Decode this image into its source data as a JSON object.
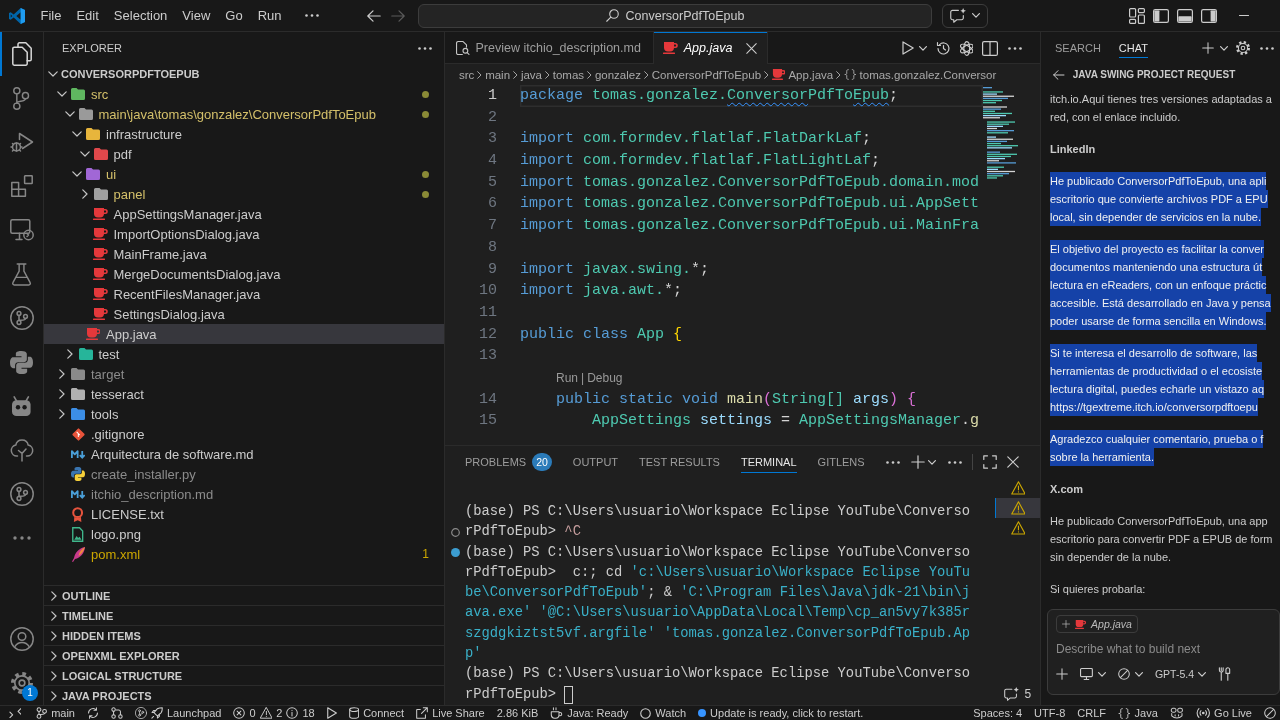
{
  "title_bar": {
    "menus": [
      "File",
      "Edit",
      "Selection",
      "View",
      "Go",
      "Run"
    ],
    "nav_buttons": [
      {
        "kind": "back",
        "disabled": false
      },
      {
        "kind": "forward",
        "disabled": true
      }
    ],
    "command_center": "ConversorPdfToEpub"
  },
  "activity_bar": {
    "items": [
      {
        "kind": "explorer",
        "selected": true
      },
      {
        "kind": "scm",
        "selected": false
      },
      {
        "kind": "debug",
        "selected": false
      },
      {
        "kind": "extensions",
        "selected": false
      },
      {
        "kind": "remote",
        "selected": false
      },
      {
        "kind": "testing",
        "selected": false
      },
      {
        "kind": "gitlens",
        "selected": false
      },
      {
        "kind": "python",
        "selected": false
      },
      {
        "kind": "robot",
        "selected": false
      },
      {
        "kind": "tree",
        "selected": false
      },
      {
        "kind": "graph",
        "selected": false
      },
      {
        "kind": "more",
        "selected": false
      }
    ],
    "bottom": [
      {
        "kind": "account"
      },
      {
        "kind": "settings",
        "badge": "1"
      }
    ]
  },
  "explorer": {
    "title": "EXPLORER",
    "tree": {
      "label": "CONVERSORPDFTOEPUB",
      "expanded": true,
      "children": [
        {
          "label": "src",
          "kind": "folder",
          "color": "#5fb760",
          "expanded": true,
          "modified": true,
          "ignored": false,
          "warning": false,
          "selected": false,
          "children": [
            {
              "label": "main\\java\\tomas\\gonzalez\\ConversorPdfToEpub",
              "kind": "folder",
              "color": "#9a9a9a",
              "expanded": true,
              "modified": true,
              "ignored": false,
              "warning": false,
              "selected": false,
              "children": [
                {
                  "label": "infrastructure",
                  "kind": "folder",
                  "color": "#e7b53c",
                  "expanded": true,
                  "modified": false,
                  "ignored": false,
                  "warning": false,
                  "selected": false,
                  "children": [
                    {
                      "label": "pdf",
                      "kind": "folder",
                      "color": "#e0484b",
                      "expanded": true,
                      "modified": false,
                      "ignored": false,
                      "warning": false,
                      "selected": false
                    }
                  ]
                },
                {
                  "label": "ui",
                  "kind": "folder",
                  "color": "#a167d6",
                  "expanded": true,
                  "modified": true,
                  "ignored": false,
                  "warning": false,
                  "selected": false,
                  "children": [
                    {
                      "label": "panel",
                      "kind": "folder",
                      "color": "#a0a0a0",
                      "expanded": false,
                      "modified": true,
                      "ignored": false,
                      "warning": false,
                      "selected": false
                    },
                    {
                      "label": "AppSettingsManager.java",
                      "kind": "java",
                      "modified": false,
                      "ignored": false,
                      "warning": false,
                      "selected": false
                    },
                    {
                      "label": "ImportOptionsDialog.java",
                      "kind": "java",
                      "modified": false,
                      "ignored": false,
                      "warning": false,
                      "selected": false
                    },
                    {
                      "label": "MainFrame.java",
                      "kind": "java",
                      "modified": false,
                      "ignored": false,
                      "warning": false,
                      "selected": false
                    },
                    {
                      "label": "MergeDocumentsDialog.java",
                      "kind": "java",
                      "modified": false,
                      "ignored": false,
                      "warning": false,
                      "selected": false
                    },
                    {
                      "label": "RecentFilesManager.java",
                      "kind": "java",
                      "modified": false,
                      "ignored": false,
                      "warning": false,
                      "selected": false
                    },
                    {
                      "label": "SettingsDialog.java",
                      "kind": "java",
                      "modified": false,
                      "ignored": false,
                      "warning": false,
                      "selected": false
                    }
                  ]
                },
                {
                  "label": "App.java",
                  "kind": "java",
                  "modified": false,
                  "ignored": false,
                  "warning": false,
                  "selected": true
                }
              ]
            },
            {
              "label": "test",
              "kind": "folder",
              "color": "#26b59a",
              "expanded": false,
              "modified": false,
              "ignored": false,
              "warning": false,
              "selected": false
            }
          ]
        },
        {
          "label": "target",
          "kind": "folder",
          "color": "#8a8a8a",
          "expanded": false,
          "modified": false,
          "ignored": true,
          "warning": false,
          "selected": false
        },
        {
          "label": "tesseract",
          "kind": "folder",
          "color": "#b0b0b0",
          "expanded": false,
          "modified": false,
          "ignored": false,
          "warning": false,
          "selected": false
        },
        {
          "label": "tools",
          "kind": "folder",
          "color": "#3c8ee6",
          "expanded": false,
          "modified": false,
          "ignored": false,
          "warning": false,
          "selected": false
        },
        {
          "label": ".gitignore",
          "kind": "git",
          "modified": false,
          "ignored": false,
          "warning": false,
          "selected": false
        },
        {
          "label": "Arquitectura de software.md",
          "kind": "markdown",
          "modified": false,
          "ignored": false,
          "warning": false,
          "selected": false
        },
        {
          "label": "create_installer.py",
          "kind": "python",
          "modified": false,
          "ignored": true,
          "warning": false,
          "selected": false
        },
        {
          "label": "itchio_description.md",
          "kind": "markdown",
          "modified": false,
          "ignored": true,
          "warning": false,
          "selected": false
        },
        {
          "label": "LICENSE.txt",
          "kind": "license",
          "modified": false,
          "ignored": false,
          "warning": false,
          "selected": false
        },
        {
          "label": "logo.png",
          "kind": "image",
          "modified": false,
          "ignored": false,
          "warning": false,
          "selected": false
        },
        {
          "label": "pom.xml",
          "kind": "xml",
          "modified": false,
          "ignored": false,
          "warning": true,
          "badge": "1",
          "selected": false
        }
      ]
    },
    "sections": [
      {
        "label": "OUTLINE",
        "expanded": false
      },
      {
        "label": "TIMELINE",
        "expanded": false
      },
      {
        "label": "HIDDEN ITEMS",
        "expanded": false
      },
      {
        "label": "OPENXML EXPLORER",
        "expanded": false
      },
      {
        "label": "LOGICAL STRUCTURE",
        "expanded": false
      },
      {
        "label": "JAVA PROJECTS",
        "expanded": false
      }
    ]
  },
  "editor": {
    "tabs": [
      {
        "label": "Preview itchio_description.md",
        "kind": "preview",
        "selected": false,
        "preview_mode": false
      },
      {
        "label": "App.java",
        "kind": "java",
        "selected": true,
        "preview_mode": true
      }
    ],
    "breadcrumbs": [
      {
        "label": "src",
        "kind": "folder"
      },
      {
        "label": "main",
        "kind": "folder"
      },
      {
        "label": "java",
        "kind": "folder"
      },
      {
        "label": "tomas",
        "kind": "folder"
      },
      {
        "label": "gonzalez",
        "kind": "folder"
      },
      {
        "label": "ConversorPdfToEpub",
        "kind": "folder"
      },
      {
        "label": "App.java",
        "kind": "java"
      },
      {
        "label": "tomas.gonzalez.Conversor",
        "kind": "namespace"
      }
    ],
    "lines": [
      {
        "kind": "code",
        "number": "1",
        "current": true,
        "tokens": [
          {
            "kind": "keyword",
            "text": "package "
          },
          {
            "kind": "type",
            "text": "tomas.gonzalez.",
            "squiggle": false
          },
          {
            "kind": "type",
            "text": "Conversor",
            "squiggle": true
          },
          {
            "kind": "type",
            "text": "PdfTo",
            "squiggle": false
          },
          {
            "kind": "type",
            "text": "Epub",
            "squiggle": true
          },
          {
            "kind": "plain",
            "text": ";"
          }
        ]
      },
      {
        "kind": "code",
        "number": "2",
        "current": false
      },
      {
        "kind": "code",
        "number": "3",
        "current": false,
        "tokens": [
          {
            "kind": "keyword",
            "text": "import "
          },
          {
            "kind": "type",
            "text": "com.formdev.flatlaf.FlatDarkLaf"
          },
          {
            "kind": "plain",
            "text": ";"
          }
        ]
      },
      {
        "kind": "code",
        "number": "4",
        "current": false,
        "tokens": [
          {
            "kind": "keyword",
            "text": "import "
          },
          {
            "kind": "type",
            "text": "com.formdev.flatlaf.FlatLightLaf"
          },
          {
            "kind": "plain",
            "text": ";"
          }
        ]
      },
      {
        "kind": "code",
        "number": "5",
        "current": false,
        "tokens": [
          {
            "kind": "keyword",
            "text": "import "
          },
          {
            "kind": "type",
            "text": "tomas.gonzalez.ConversorPdfToEpub.domain.mod"
          }
        ]
      },
      {
        "kind": "code",
        "number": "6",
        "current": false,
        "tokens": [
          {
            "kind": "keyword",
            "text": "import "
          },
          {
            "kind": "type",
            "text": "tomas.gonzalez.ConversorPdfToEpub.ui.AppSett"
          }
        ]
      },
      {
        "kind": "code",
        "number": "7",
        "current": false,
        "tokens": [
          {
            "kind": "keyword",
            "text": "import "
          },
          {
            "kind": "type",
            "text": "tomas.gonzalez.ConversorPdfToEpub.ui.MainFra"
          }
        ]
      },
      {
        "kind": "code",
        "number": "8",
        "current": false
      },
      {
        "kind": "code",
        "number": "9",
        "current": false,
        "tokens": [
          {
            "kind": "keyword",
            "text": "import "
          },
          {
            "kind": "type",
            "text": "javax.swing."
          },
          {
            "kind": "plain",
            "text": "*;"
          }
        ]
      },
      {
        "kind": "code",
        "number": "10",
        "current": false,
        "tokens": [
          {
            "kind": "keyword",
            "text": "import "
          },
          {
            "kind": "type",
            "text": "java.awt."
          },
          {
            "kind": "plain",
            "text": "*;"
          }
        ]
      },
      {
        "kind": "code",
        "number": "11",
        "current": false
      },
      {
        "kind": "code",
        "number": "12",
        "current": false,
        "tokens": [
          {
            "kind": "keyword",
            "text": "public class "
          },
          {
            "kind": "type",
            "text": "App "
          },
          {
            "kind": "bracket1",
            "text": "{"
          }
        ]
      },
      {
        "kind": "code",
        "number": "13",
        "current": false
      },
      {
        "kind": "codelens",
        "links": [
          "Run",
          "Debug"
        ],
        "separator": "|"
      },
      {
        "kind": "code",
        "number": "14",
        "current": false,
        "tokens": [
          {
            "kind": "keyword",
            "text": "    public static void "
          },
          {
            "kind": "func",
            "text": "main"
          },
          {
            "kind": "bracket2",
            "text": "("
          },
          {
            "kind": "type",
            "text": "String[] "
          },
          {
            "kind": "var",
            "text": "args"
          },
          {
            "kind": "bracket2",
            "text": ") {"
          }
        ]
      },
      {
        "kind": "code",
        "number": "15",
        "current": false,
        "tokens": [
          {
            "kind": "type",
            "text": "        AppSettings "
          },
          {
            "kind": "var",
            "text": "settings "
          },
          {
            "kind": "plain",
            "text": "= "
          },
          {
            "kind": "type",
            "text": "AppSettingsManager"
          },
          {
            "kind": "plain",
            "text": "."
          },
          {
            "kind": "func",
            "text": "g"
          }
        ]
      }
    ]
  },
  "panel": {
    "tabs": [
      {
        "label": "PROBLEMS",
        "badge": "20",
        "selected": false
      },
      {
        "label": "OUTPUT",
        "selected": false
      },
      {
        "label": "TEST RESULTS",
        "selected": false
      },
      {
        "label": "TERMINAL",
        "selected": true
      },
      {
        "label": "GITLENS",
        "selected": false
      }
    ],
    "terminal": [
      {
        "kind": "plain",
        "cursor": false,
        "tokens": [
          {
            "kind": "plain",
            "text": "(base) PS C:\\Users\\usuario\\Workspace Eclipse YouTube\\Converso"
          }
        ]
      },
      {
        "kind": "pending",
        "cursor": false,
        "tokens": [
          {
            "kind": "plain",
            "text": "rPdfToEpub> "
          },
          {
            "kind": "ctrl",
            "text": "^C"
          }
        ]
      },
      {
        "kind": "success",
        "cursor": false,
        "tokens": [
          {
            "kind": "plain",
            "text": "(base) PS C:\\Users\\usuario\\Workspace Eclipse YouTube\\Converso"
          }
        ]
      },
      {
        "kind": "plain",
        "cursor": false,
        "tokens": [
          {
            "kind": "plain",
            "text": "rPdfToEpub>  c:; cd "
          },
          {
            "kind": "string",
            "text": "'c:\\Users\\usuario\\Workspace Eclipse YouTu"
          }
        ]
      },
      {
        "kind": "plain",
        "cursor": false,
        "tokens": [
          {
            "kind": "string",
            "text": "be\\ConversorPdfToEpub'"
          },
          {
            "kind": "plain",
            "text": "; & "
          },
          {
            "kind": "string",
            "text": "'C:\\Program Files\\Java\\jdk-21\\bin\\j"
          }
        ]
      },
      {
        "kind": "plain",
        "cursor": false,
        "tokens": [
          {
            "kind": "string",
            "text": "ava.exe' '@C:\\Users\\usuario\\AppData\\Local\\Temp\\cp_an5vy7k385r"
          }
        ]
      },
      {
        "kind": "plain",
        "cursor": false,
        "tokens": [
          {
            "kind": "string",
            "text": "szgdgkiztst5vf.argfile' 'tomas.gonzalez.ConversorPdfToEpub.Ap"
          }
        ]
      },
      {
        "kind": "plain",
        "cursor": false,
        "tokens": [
          {
            "kind": "string",
            "text": "p'"
          }
        ]
      },
      {
        "kind": "plain",
        "cursor": false,
        "tokens": [
          {
            "kind": "plain",
            "text": "(base) PS C:\\Users\\usuario\\Workspace Eclipse YouTube\\Converso"
          }
        ]
      },
      {
        "kind": "plain",
        "cursor": true,
        "tokens": [
          {
            "kind": "plain",
            "text": "rPdfToEpub> "
          }
        ]
      }
    ],
    "terminal_tabs": [
      {
        "selected": false
      },
      {
        "selected": true
      },
      {
        "selected": false
      }
    ],
    "chat_count": "5"
  },
  "chat": {
    "tabs": [
      {
        "label": "SEARCH",
        "selected": false
      },
      {
        "label": "CHAT",
        "selected": true
      }
    ],
    "title": "JAVA SWING PROJECT REQUEST",
    "messages": [
      {
        "kind": "text",
        "selected": false,
        "lines": [
          "itch.io.Aquí tienes tres versiones adaptadas a",
          "red, con el enlace incluido."
        ]
      },
      {
        "kind": "heading",
        "selected": false,
        "lines": [
          "LinkedIn"
        ]
      },
      {
        "kind": "text",
        "selected": true,
        "lines": [
          "He publicado ConversorPdfToEpub, una apli",
          "escritorio que convierte archivos PDF a EPU",
          "local, sin depender de servicios en la nube."
        ]
      },
      {
        "kind": "text",
        "selected": true,
        "lines": [
          "El objetivo del proyecto es facilitar la conver",
          "documentos manteniendo una estructura út",
          "lectura en eReaders, con un enfoque práctic",
          "accesible. Está desarrollado en Java y pensa",
          "poder usarse de forma sencilla en Windows."
        ]
      },
      {
        "kind": "text",
        "selected": true,
        "lines": [
          "Si te interesa el desarrollo de software, las",
          "herramientas de productividad o el ecosiste",
          "lectura digital, puedes echarle un vistazo aq",
          "https://tgextreme.itch.io/conversorpdftoepu"
        ]
      },
      {
        "kind": "text",
        "selected": true,
        "lines": [
          "Agradezco cualquier comentario, prueba o f",
          "sobre la herramienta."
        ]
      },
      {
        "kind": "heading",
        "selected": false,
        "lines": [
          "X.com"
        ]
      },
      {
        "kind": "text",
        "selected": false,
        "lines": [
          "He publicado ConversorPdfToEpub, una app",
          "escritorio para convertir PDF a EPUB de form",
          "sin depender de la nube."
        ]
      },
      {
        "kind": "text",
        "selected": false,
        "lines": [
          "Si quieres probarla:"
        ]
      }
    ],
    "input": {
      "attachment": "App.java",
      "placeholder": "Describe what to build next",
      "model": "GPT-5.4"
    }
  },
  "status_bar": {
    "left": [
      {
        "kind": "remote"
      },
      {
        "kind": "branch",
        "text": "main"
      },
      {
        "kind": "sync"
      },
      {
        "kind": "graph"
      },
      {
        "kind": "launchpad",
        "text": "Launchpad"
      },
      {
        "kind": "problems",
        "errors": "0",
        "warnings": "2",
        "infos": "18"
      },
      {
        "kind": "run"
      },
      {
        "kind": "database",
        "text": "Connect"
      },
      {
        "kind": "liveshare",
        "text": "Live Share"
      },
      {
        "kind": "plain",
        "text": "2.86 KiB"
      },
      {
        "kind": "java",
        "text": "Java: Ready"
      },
      {
        "kind": "watch",
        "text": "Watch"
      },
      {
        "kind": "update",
        "text": "Update is ready, click to restart."
      }
    ],
    "right": [
      {
        "kind": "plain",
        "text": "Spaces: 4"
      },
      {
        "kind": "plain",
        "text": "UTF-8"
      },
      {
        "kind": "plain",
        "text": "CRLF"
      },
      {
        "kind": "language",
        "text": "Java"
      },
      {
        "kind": "copilot"
      },
      {
        "kind": "golive",
        "text": "Go Live"
      },
      {
        "kind": "blocked"
      }
    ]
  }
}
